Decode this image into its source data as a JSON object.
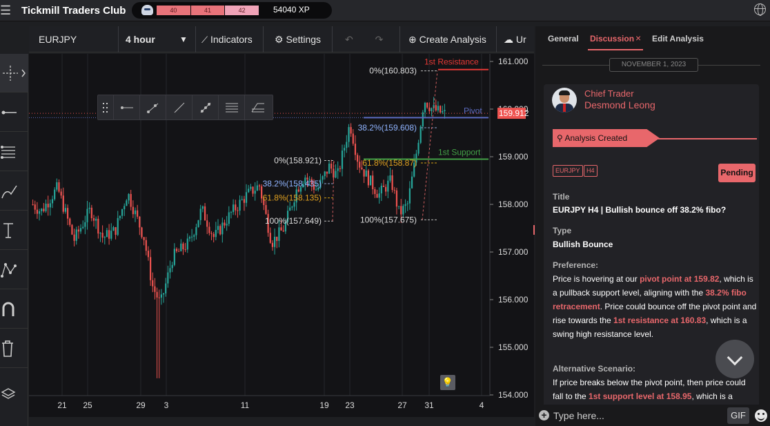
{
  "app": {
    "title": "Tickmill Traders Club",
    "levels": [
      "40",
      "41",
      "42"
    ],
    "xp": "54040 XP"
  },
  "toolbar": {
    "symbol": "EURJPY",
    "timeframe": "4 hour",
    "indicators": "Indicators",
    "settings": "Settings",
    "create_analysis": "Create Analysis",
    "cut_label": "Ur"
  },
  "chart": {
    "price_labels": [
      "161.000",
      "160.000",
      "159.000",
      "158.000",
      "157.000",
      "156.000",
      "155.000",
      "154.000"
    ],
    "date_labels": [
      "21",
      "25",
      "29",
      "3",
      "11",
      "19",
      "23",
      "27",
      "31",
      "4"
    ],
    "current_price": "159.912",
    "lines": {
      "resistance": "1st Resistance",
      "pivot": "Pivot",
      "support": "1st Support"
    },
    "fib_labels": [
      "0%(160.803)",
      "38.2%(159.608)",
      "61.8%(158.87)",
      "100%(157.675)",
      "0%(158.921)",
      "38.2%(158.435)",
      "61.8%(158.135)",
      "100%(157.649)"
    ],
    "colors": {
      "up": "#26a69a",
      "down": "#ef5350",
      "resistance": "#e53935",
      "support": "#43a047",
      "pivot": "#5c6bc0"
    }
  },
  "chart_data": {
    "type": "candlestick",
    "symbol": "EURJPY",
    "timeframe": "4 hour",
    "ylim": [
      154.0,
      161.0
    ],
    "x_ticks": [
      "21",
      "25",
      "29",
      "3",
      "11",
      "19",
      "23",
      "27",
      "31",
      "4"
    ],
    "current_price": 159.912,
    "levels": [
      {
        "name": "1st Resistance",
        "value": 160.83
      },
      {
        "name": "Pivot",
        "value": 159.82
      },
      {
        "name": "1st Support",
        "value": 158.95
      }
    ],
    "fib_right": [
      {
        "label": "0%",
        "value": 160.803
      },
      {
        "label": "38.2%",
        "value": 159.608
      },
      {
        "label": "61.8%",
        "value": 158.87
      },
      {
        "label": "100%",
        "value": 157.675
      }
    ],
    "fib_left": [
      {
        "label": "0%",
        "value": 158.921
      },
      {
        "label": "38.2%",
        "value": 158.435
      },
      {
        "label": "61.8%",
        "value": 158.135
      },
      {
        "label": "100%",
        "value": 157.649
      }
    ],
    "anchors": [
      {
        "t": 0,
        "p": 158.0
      },
      {
        "t": 0.02,
        "p": 157.85
      },
      {
        "t": 0.06,
        "p": 158.35
      },
      {
        "t": 0.1,
        "p": 157.25
      },
      {
        "t": 0.14,
        "p": 157.9
      },
      {
        "t": 0.17,
        "p": 157.3
      },
      {
        "t": 0.2,
        "p": 157.45
      },
      {
        "t": 0.23,
        "p": 158.25
      },
      {
        "t": 0.27,
        "p": 157.3
      },
      {
        "t": 0.29,
        "p": 156.3
      },
      {
        "t": 0.31,
        "p": 155.9
      },
      {
        "t": 0.34,
        "p": 156.9
      },
      {
        "t": 0.38,
        "p": 157.2
      },
      {
        "t": 0.41,
        "p": 157.9
      },
      {
        "t": 0.44,
        "p": 157.3
      },
      {
        "t": 0.48,
        "p": 157.8
      },
      {
        "t": 0.52,
        "p": 158.2
      },
      {
        "t": 0.55,
        "p": 158.4
      },
      {
        "t": 0.58,
        "p": 157.2
      },
      {
        "t": 0.61,
        "p": 157.5
      },
      {
        "t": 0.64,
        "p": 158.3
      },
      {
        "t": 0.66,
        "p": 158.6
      },
      {
        "t": 0.69,
        "p": 158.3
      },
      {
        "t": 0.72,
        "p": 158.8
      },
      {
        "t": 0.74,
        "p": 158.6
      },
      {
        "t": 0.77,
        "p": 159.7
      },
      {
        "t": 0.79,
        "p": 158.9
      },
      {
        "t": 0.81,
        "p": 158.6
      },
      {
        "t": 0.84,
        "p": 158.2
      },
      {
        "t": 0.87,
        "p": 158.5
      },
      {
        "t": 0.89,
        "p": 157.8
      },
      {
        "t": 0.91,
        "p": 158.0
      },
      {
        "t": 0.93,
        "p": 159.0
      },
      {
        "t": 0.95,
        "p": 160.2
      },
      {
        "t": 0.97,
        "p": 160.0
      },
      {
        "t": 1.0,
        "p": 159.9
      }
    ]
  },
  "panel": {
    "tabs": [
      "General",
      "Discussion",
      "Edit Analysis"
    ],
    "close_icon": "×",
    "date": "NOVEMBER 1, 2023",
    "role": "Chief Trader",
    "user": "Desmond Leong",
    "badge": "Analysis Created",
    "tags": [
      "EURJPY",
      "H4"
    ],
    "status": "Pending",
    "title_label": "Title",
    "title_value": "EURJPY H4 | Bullish bounce off 38.2% fibo?",
    "type_label": "Type",
    "type_value": "Bullish Bounce",
    "pref_label": "Preference:",
    "pref_parts": [
      " Price is hovering at our ",
      "pivot point at 159.82",
      ", which is a pullback support level, aligning with the ",
      "38.2% fibo retracement",
      ". Price could bounce off the pivot point and rise towards the ",
      "1st resistance at 160.83",
      ", which is a swing high resistance level."
    ],
    "alt_label": "Alternative Scenario:",
    "alt_parts": [
      " If price breaks below the pivot point, then price could fall to the ",
      "1st support level at 158.95",
      ", which is a"
    ],
    "input_placeholder": "Type here...",
    "gif": "GIF"
  }
}
